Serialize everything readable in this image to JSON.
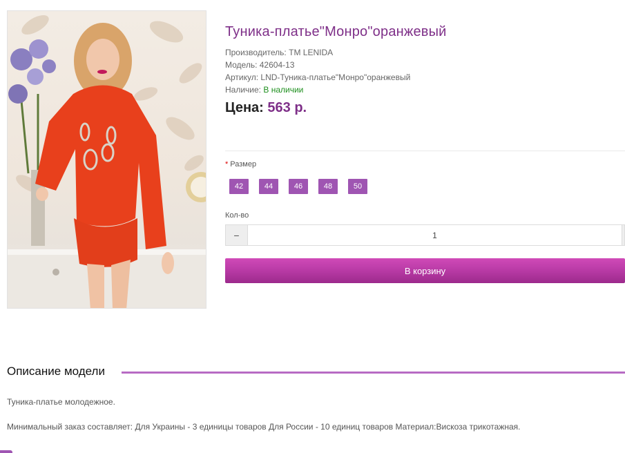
{
  "product": {
    "title": "Туника-платье\"Монро\"оранжевый",
    "manufacturer_label": "Производитель:",
    "manufacturer_value": "TM LENIDA",
    "model_label": "Модель:",
    "model_value": "42604-13",
    "sku_label": "Артикул:",
    "sku_value": "LND-Туника-платье\"Монро\"оранжевый",
    "availability_label": "Наличие:",
    "availability_value": "В наличии",
    "price_label": "Цена:",
    "price_value": "563 р."
  },
  "options": {
    "required_mark": "*",
    "size_label": "Размер",
    "sizes": [
      "42",
      "44",
      "46",
      "48",
      "50"
    ],
    "qty_label": "Кол-во",
    "qty_minus": "−",
    "qty_value": "1",
    "cart_button": "В корзину"
  },
  "description": {
    "heading": "Описание модели",
    "p1": "Туника-платье молодежное.",
    "p2": "Минимальный заказ составляет: Для Украины - 3 единицы товаров Для России - 10 единиц товаров Материал:Вискоза трикотажная."
  },
  "colors": {
    "accent": "#7e2f88",
    "size_button": "#9f55b2",
    "cart_button": "#b83aa5",
    "in_stock": "#1e8f1e"
  },
  "icons": {
    "qty_minus": "minus-icon"
  }
}
